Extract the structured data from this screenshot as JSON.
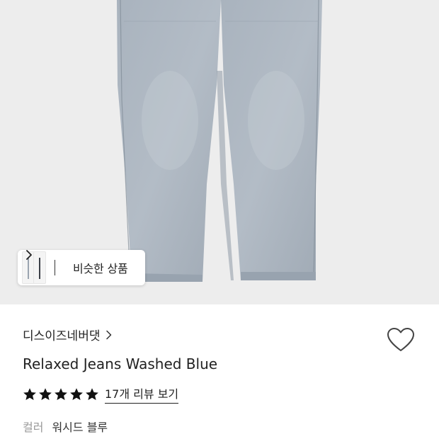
{
  "similar_products": {
    "label": "비슷한 상품"
  },
  "product": {
    "brand": "디스이즈네버댓",
    "name": "Relaxed Jeans Washed Blue",
    "rating_stars": 5,
    "review_link": "17개 리뷰 보기",
    "color_label": "컬러",
    "color_value": "워시드 블루"
  },
  "icons": {
    "chevron": "chevron-right-icon",
    "wish": "heart-outline-icon",
    "star": "star-filled-icon"
  },
  "colors": {
    "hero_bg": "#ededed",
    "denim": "#a7b1bc",
    "text": "#222222",
    "muted": "#999999"
  }
}
